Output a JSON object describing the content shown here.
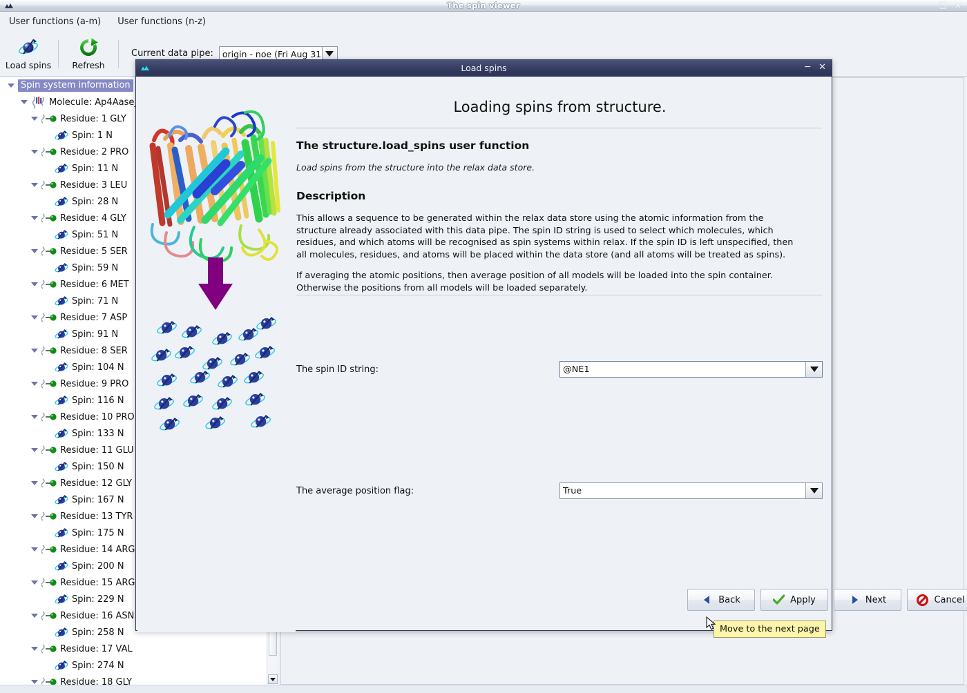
{
  "main_window": {
    "title": "The spin viewer",
    "icon": "app-icon",
    "controls": {
      "minimize": "–",
      "maximize": "❐",
      "close": "✕"
    }
  },
  "menubar": {
    "items": [
      {
        "label": "User functions (a-m)"
      },
      {
        "label": "User functions (n-z)"
      }
    ]
  },
  "toolbar": {
    "buttons": [
      {
        "label": "Load spins",
        "icon": "spin-icon"
      },
      {
        "label": "Refresh",
        "icon": "refresh-icon"
      }
    ],
    "pipe_label": "Current data pipe:",
    "pipe_value": "origin - noe (Fri Aug 31 :",
    "pipe_arrow_icon": "chevron-down-icon"
  },
  "tree": {
    "root": {
      "label": "Spin system information",
      "selected": true
    },
    "molecule": {
      "label": "Molecule: Ap4Aase_",
      "icon": "molecule-icon"
    },
    "nodes": [
      {
        "residue": "Residue: 1 GLY",
        "spin": "Spin: 1 N"
      },
      {
        "residue": "Residue: 2 PRO",
        "spin": "Spin: 11 N"
      },
      {
        "residue": "Residue: 3 LEU",
        "spin": "Spin: 28 N"
      },
      {
        "residue": "Residue: 4 GLY",
        "spin": "Spin: 51 N"
      },
      {
        "residue": "Residue: 5 SER",
        "spin": "Spin: 59 N"
      },
      {
        "residue": "Residue: 6 MET",
        "spin": "Spin: 71 N"
      },
      {
        "residue": "Residue: 7 ASP",
        "spin": "Spin: 91 N"
      },
      {
        "residue": "Residue: 8 SER",
        "spin": "Spin: 104 N"
      },
      {
        "residue": "Residue: 9 PRO",
        "spin": "Spin: 116 N"
      },
      {
        "residue": "Residue: 10 PRO",
        "spin": "Spin: 133 N"
      },
      {
        "residue": "Residue: 11 GLU",
        "spin": "Spin: 150 N"
      },
      {
        "residue": "Residue: 12 GLY",
        "spin": "Spin: 167 N"
      },
      {
        "residue": "Residue: 13 TYR",
        "spin": "Spin: 175 N"
      },
      {
        "residue": "Residue: 14 ARG",
        "spin": "Spin: 200 N"
      },
      {
        "residue": "Residue: 15 ARG",
        "spin": "Spin: 229 N"
      },
      {
        "residue": "Residue: 16 ASN",
        "spin": "Spin: 258 N"
      },
      {
        "residue": "Residue: 17 VAL",
        "spin": "Spin: 274 N"
      },
      {
        "residue": "Residue: 18 GLY",
        "spin": null
      }
    ]
  },
  "dialog": {
    "title": "Load spins",
    "controls": {
      "minimize": "–",
      "close": "✕"
    },
    "page_title": "Loading spins from structure.",
    "section_title": "The structure.load_spins user function",
    "section_subtitle": "Load spins from the structure into the relax data store.",
    "description_heading": "Description",
    "description_p1": "This allows a sequence to be generated within the relax data store using the atomic information from the structure already associated with this data pipe.  The spin ID string is used to select which molecules, which residues, and which atoms will be recognised as spin systems within relax.  If the spin ID is left unspecified, then all molecules, residues, and atoms will be placed within the data store (and all atoms will be treated as spins).",
    "description_p2": "If averaging the atomic positions, then average position of all models will be loaded into the spin container. Otherwise the positions from all models will be loaded separately.",
    "fields": [
      {
        "label": "The spin ID string:",
        "value": "@NE1",
        "arrow_icon": "chevron-down-icon"
      },
      {
        "label": "The average position flag:",
        "value": "True",
        "arrow_icon": "chevron-down-icon"
      }
    ],
    "buttons": [
      {
        "label": "Back",
        "icon": "triangle-left-icon"
      },
      {
        "label": "Apply",
        "icon": "check-icon"
      },
      {
        "label": "Next",
        "icon": "triangle-right-icon"
      },
      {
        "label": "Cancel",
        "icon": "no-entry-icon"
      }
    ],
    "artwork": {
      "name": "protein-structure-and-spins-graphic"
    }
  },
  "tooltip": {
    "text": "Move to the next page"
  },
  "colors": {
    "selection": "#8589c6",
    "dialog_titlebar": "#333a5e",
    "panel_bg": "#eef1f6",
    "tooltip_bg": "#fdf5a9",
    "arrow_purple": "#800080"
  }
}
